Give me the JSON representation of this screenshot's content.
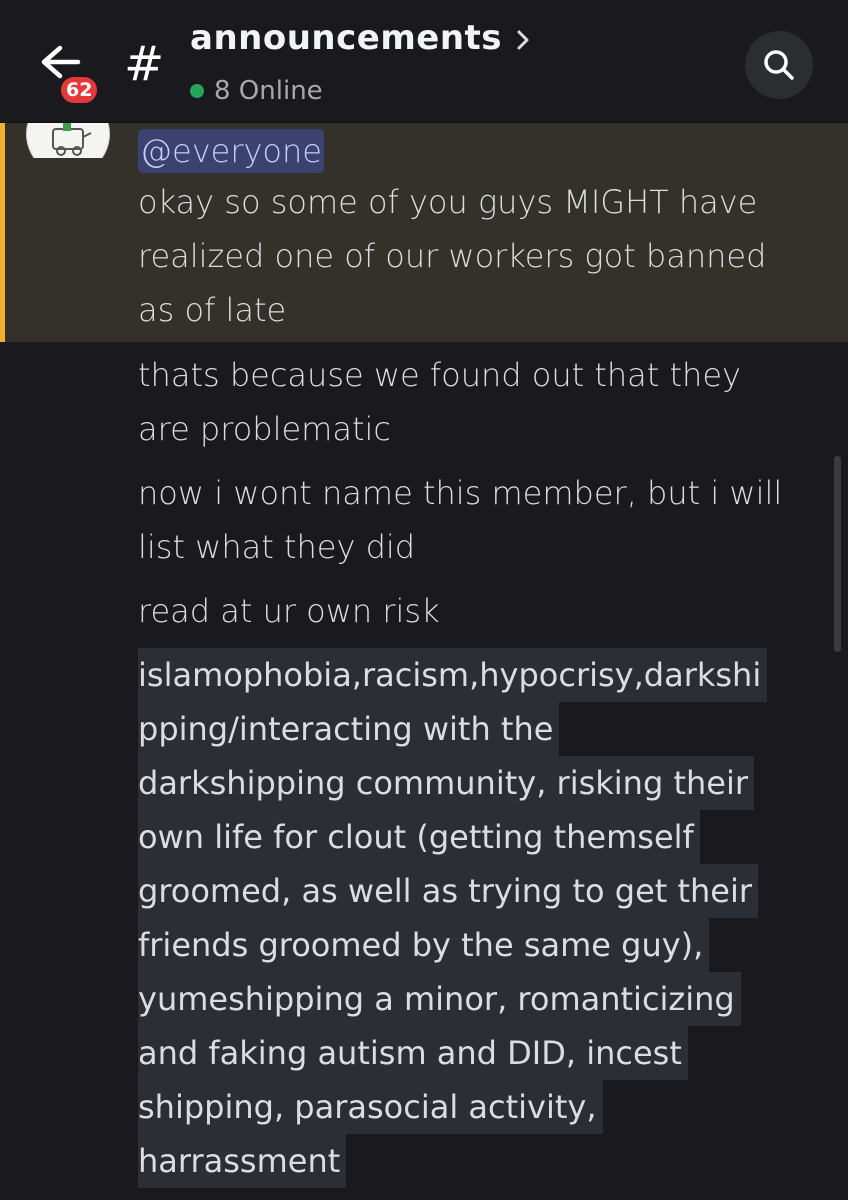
{
  "header": {
    "back_icon": "arrow-left-icon",
    "unread_badge": "62",
    "channel_hash": "#",
    "channel_name": "announcements",
    "chevron_icon": "chevron-right-icon",
    "online_status": "8 Online",
    "search_icon": "search-icon",
    "status_color": "#23a55a"
  },
  "messages": {
    "mention": "@everyone",
    "highlighted": [
      "okay so some of you guys MIGHT have",
      "realized one of our workers got banned",
      "as of late"
    ],
    "paragraph1": [
      "thats because we found out that they",
      "are problematic"
    ],
    "paragraph2": [
      "now i wont name this member, but i will",
      "list what they did"
    ],
    "paragraph3": "read at ur own risk",
    "list_lines": [
      "islamophobia,racism,hypocrisy,darkshi",
      "pping/interacting with the",
      "darkshipping community, risking their",
      "own life for clout (getting themself",
      "groomed, as well as trying to get their",
      "friends groomed by the same guy),",
      "yumeshipping a minor, romanticizing",
      "and faking autism and DID, incest",
      "shipping, parasocial activity,",
      "harrassment"
    ]
  },
  "colors": {
    "background": "#1a1a1e",
    "mention_highlight": "#34312a",
    "mention_bar": "#f0b132",
    "badge": "#e5383b"
  }
}
